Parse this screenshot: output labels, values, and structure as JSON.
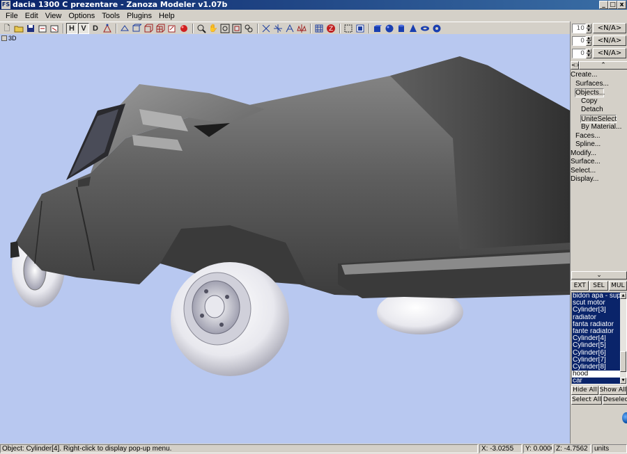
{
  "window": {
    "app_icon": "FS",
    "title": "dacia 1300 C prezentare - Zanoza Modeler v1.07b",
    "minimize": "_",
    "maximize": "□",
    "close": "x"
  },
  "menu": [
    "File",
    "Edit",
    "View",
    "Options",
    "Tools",
    "Plugins",
    "Help"
  ],
  "toolbar": {
    "view_h": "H",
    "view_v": "V",
    "view_d": "D"
  },
  "viewport": {
    "label": "3D"
  },
  "right_panel": {
    "spinners": [
      {
        "value": "10",
        "button": "<N/A>"
      },
      {
        "value": "0",
        "button": "<N/A>"
      },
      {
        "value": "0",
        "button": "<N/A>"
      }
    ],
    "scroll_left": "<>",
    "scroll_up": "⌃",
    "commands": [
      {
        "label": "Create...",
        "level": 0
      },
      {
        "label": "Surfaces...",
        "level": 1
      },
      {
        "label": "Objects...",
        "level": 1
      },
      {
        "label": "Copy",
        "level": 2
      },
      {
        "label": "Detach",
        "level": 2
      },
      {
        "label": "UniteSelect",
        "level": 2
      },
      {
        "label": "By Material...",
        "level": 2
      },
      {
        "label": "Faces...",
        "level": 1
      },
      {
        "label": "Spline...",
        "level": 1
      },
      {
        "label": "Modify...",
        "level": 0
      },
      {
        "label": "Surface...",
        "level": 0
      },
      {
        "label": "Select...",
        "level": 0
      },
      {
        "label": "Display...",
        "level": 0
      }
    ],
    "scroll_down": "⌄",
    "modes": [
      "EXT",
      "SEL",
      "MUL"
    ],
    "objects": [
      {
        "name": "bidon apa - suport",
        "selected": true
      },
      {
        "name": "scut motor",
        "selected": true
      },
      {
        "name": "Cylinder[3]",
        "selected": true
      },
      {
        "name": "radiator",
        "selected": true
      },
      {
        "name": "fanta radiator",
        "selected": true
      },
      {
        "name": "fante radiator",
        "selected": true
      },
      {
        "name": "Cylinder[4]",
        "selected": true
      },
      {
        "name": "Cylinder[5]",
        "selected": true
      },
      {
        "name": "Cylinder[6]",
        "selected": true
      },
      {
        "name": "Cylinder[7]",
        "selected": true
      },
      {
        "name": "Cylinder[8]",
        "selected": true
      },
      {
        "name": "hood",
        "selected": false
      },
      {
        "name": "car",
        "selected": true
      }
    ],
    "hide_all": "Hide All",
    "show_all": "Show All",
    "select_all": "Select All",
    "deselect": "Deselect"
  },
  "status": {
    "message": "Object: Cylinder[4]. Right-click to display pop-up menu.",
    "x": "X: -3.0255",
    "y": "Y: 0.0000",
    "z": "Z: -4.7562",
    "units": "units"
  },
  "colors": {
    "title_gradient_start": "#0a246a",
    "title_gradient_end": "#3a6ea5",
    "viewport_bg": "#b8c8f0",
    "panel_bg": "#d4d0c8",
    "selection": "#0a246a"
  }
}
